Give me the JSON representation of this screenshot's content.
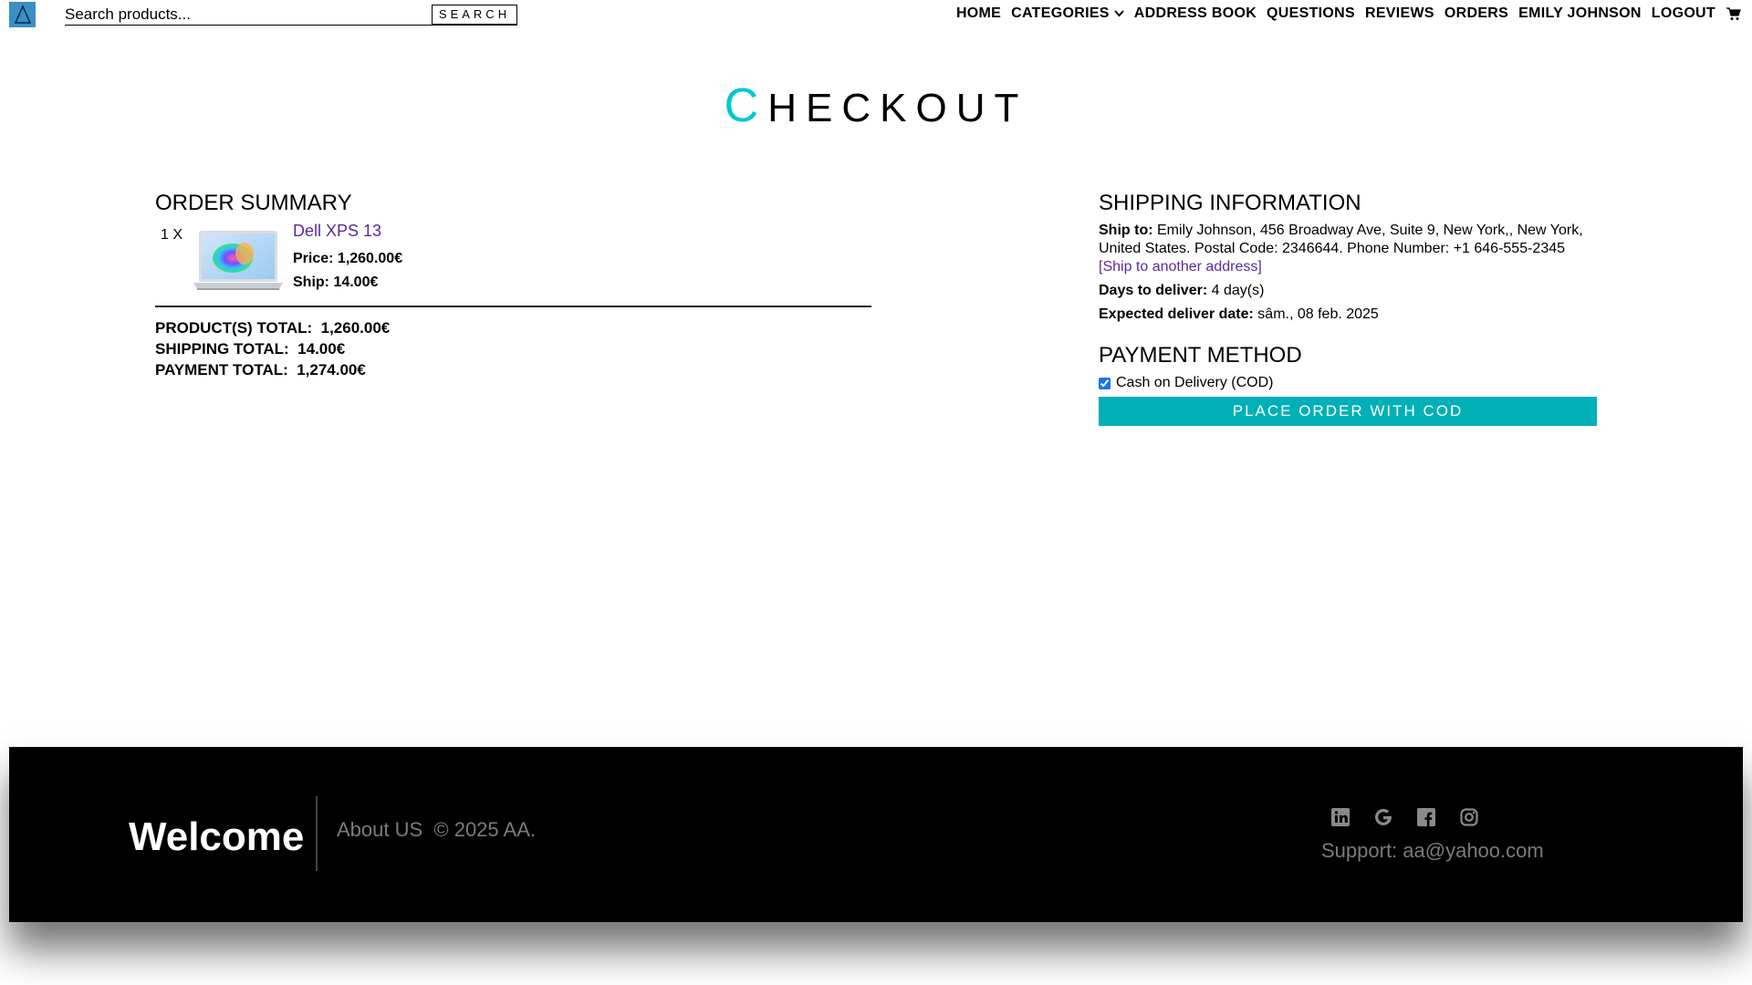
{
  "header": {
    "search_placeholder": "Search products...",
    "search_button": "SEARCH",
    "nav": {
      "home": "HOME",
      "categories": "CATEGORIES",
      "address_book": "ADDRESS BOOK",
      "questions": "QUESTIONS",
      "reviews": "REVIEWS",
      "orders": "ORDERS",
      "user": "EMILY JOHNSON",
      "logout": "LOGOUT"
    }
  },
  "page": {
    "title_first": "C",
    "title_rest": "HECKOUT"
  },
  "order_summary": {
    "heading": "ORDER SUMMARY",
    "item": {
      "qty": "1 X",
      "name": "Dell XPS 13",
      "price": "Price: 1,260.00€",
      "ship": "Ship: 14.00€"
    },
    "products_total": "PRODUCT(S) TOTAL:  1,260.00€",
    "shipping_total": "SHIPPING TOTAL:  14.00€",
    "payment_total": "PAYMENT TOTAL:  1,274.00€"
  },
  "shipping": {
    "heading": "SHIPPING INFORMATION",
    "ship_to_label": "Ship to:",
    "ship_to_value": "Emily Johnson, 456 Broadway Ave, Suite 9, New York,, New York, United States. Postal Code: 2346644. Phone Number: +1 646-555-2345",
    "another_address": "[Ship to another address]",
    "days_label": "Days to deliver:",
    "days_value": "4 day(s)",
    "expected_label": "Expected deliver date:",
    "expected_value": "sâm., 08 feb. 2025"
  },
  "payment": {
    "heading": "PAYMENT METHOD",
    "option": "Cash on Delivery (COD)",
    "place_order": "PLACE ORDER WITH COD"
  },
  "footer": {
    "welcome": "Welcome",
    "about": "About US  © 2025 AA.",
    "support": "Support: aa@yahoo.com",
    "social_icons": [
      "linkedin-icon",
      "google-icon",
      "facebook-icon",
      "instagram-icon"
    ]
  },
  "colors": {
    "accent": "#00c7d4",
    "button": "#00b0b6",
    "link": "#5b2a9a",
    "logo": "#3a8fc4"
  }
}
